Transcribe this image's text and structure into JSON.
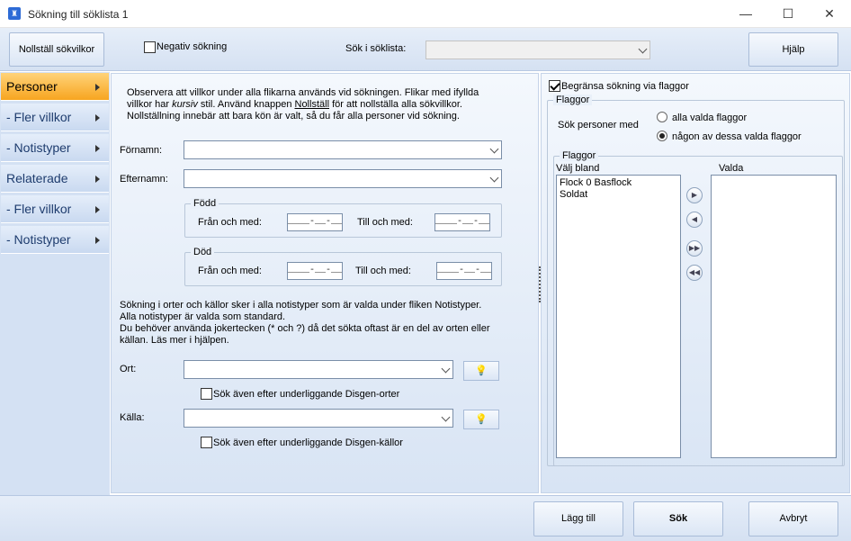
{
  "window": {
    "title": "Sökning till söklista 1",
    "minimize": "—",
    "maximize": "☐",
    "close": "✕"
  },
  "toolbar": {
    "reset_label": "Nollställ sökvilkor",
    "negative_label": "Negativ sökning",
    "search_in_label": "Sök i söklista:",
    "search_in_value": "",
    "help_label": "Hjälp"
  },
  "nav": {
    "items": [
      "Personer",
      "- Fler villkor",
      "- Notistyper",
      "Relaterade",
      "- Fler villkor",
      "- Notistyper"
    ],
    "active": 0
  },
  "main": {
    "info_line1": "Observera att villkor under alla flikarna används vid sökningen. Flikar med ifyllda",
    "info_line2a": "villkor har ",
    "info_line2_italic": "kursiv",
    "info_line2b": " stil. Använd knappen ",
    "info_line2_link": "Nollställ",
    "info_line2c": " för att nollställa alla sökvillkor.",
    "info_line3": "Nollställning innebär att bara kön är valt, så du får alla personer vid sökning.",
    "fornamn_label": "Förnamn:",
    "efternamn_label": "Efternamn:",
    "fodd_group": "Född",
    "dod_group": "Död",
    "from_label": "Från och med:",
    "to_label": "Till och med:",
    "date_mask": "____-__-__",
    "places_line1": "Sökning i orter och källor sker i alla notistyper som är valda under fliken Notistyper.",
    "places_line2": "Alla notistyper är valda som standard.",
    "places_line3": "Du behöver använda jokertecken (* och ?) då det sökta oftast är en del av orten eller",
    "places_line4": "källan. Läs mer i hjälpen.",
    "ort_label": "Ort:",
    "ort_sub_label": "Sök även efter underliggande Disgen-orter",
    "kalla_label": "Källa:",
    "kalla_sub_label": "Sök även efter underliggande Disgen-källor"
  },
  "flags": {
    "limit_label": "Begränsa sökning via flaggor",
    "group_title": "Flaggor",
    "search_persons_label": "Sök personer med",
    "radio_all": "alla valda flaggor",
    "radio_any": "någon av dessa valda flaggor",
    "inner_group_title": "Flaggor",
    "choose_label": "Välj bland",
    "selected_label": "Valda",
    "available": [
      "Flock 0 Basflock",
      "Soldat"
    ],
    "selected": []
  },
  "bottom": {
    "add_label": "Lägg till",
    "search_label": "Sök",
    "cancel_label": "Avbryt"
  }
}
